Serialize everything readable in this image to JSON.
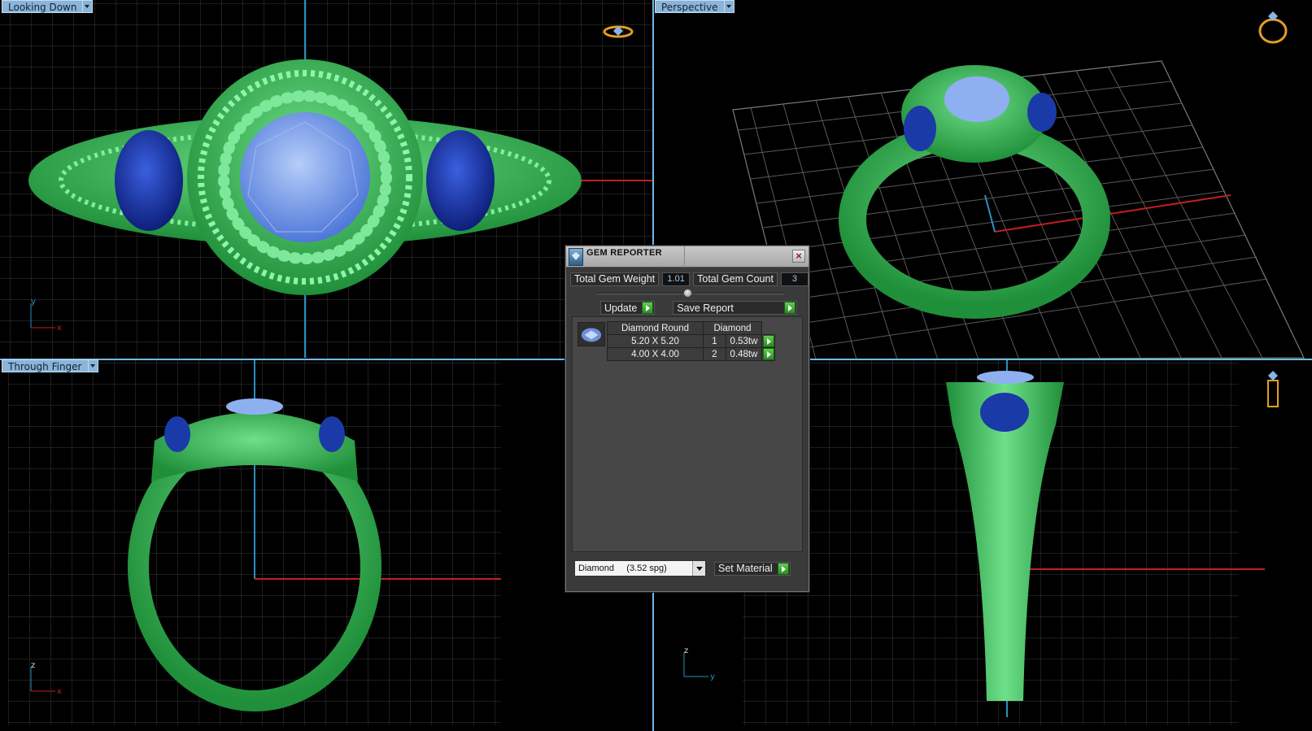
{
  "viewports": {
    "top_left": {
      "label": "Looking Down",
      "axis_y": "y",
      "axis_x": "x"
    },
    "top_right": {
      "label": "Perspective"
    },
    "bottom_left": {
      "label": "Through Finger",
      "axis_y": "z",
      "axis_x": "x"
    },
    "bottom_right": {
      "axis_y": "z",
      "axis_x": "y"
    }
  },
  "gem_reporter": {
    "title": "GEM REPORTER",
    "total_weight_label": "Total Gem Weight",
    "total_weight_value": "1.01",
    "total_count_label": "Total Gem Count",
    "total_count_value": "3",
    "update_label": "Update",
    "save_report_label": "Save Report",
    "table": {
      "headers": [
        "Diamond Round",
        "Diamond"
      ],
      "rows": [
        {
          "size": "5.20 X 5.20",
          "count": "1",
          "weight": "0.53tw"
        },
        {
          "size": "4.00 X 4.00",
          "count": "2",
          "weight": "0.48tw"
        }
      ]
    },
    "material_select": {
      "value": "Diamond     (3.52 spg)"
    },
    "set_material_label": "Set Material"
  },
  "colors": {
    "ring_green": "#3fbf5f",
    "sapphire": "#1f3fb0",
    "center_stone": "#7aa0e8",
    "grid": "#3a3a3a",
    "axis_x": "#c02020",
    "axis_y": "#2a90c0",
    "viewport_label_bg": "#8ab4d8",
    "viewport_border": "#6fb8e6"
  },
  "icons": [
    "ring-nav-icon",
    "close-icon",
    "gem-icon",
    "app-icon",
    "go-arrow-icon",
    "dropdown-arrow-icon"
  ]
}
